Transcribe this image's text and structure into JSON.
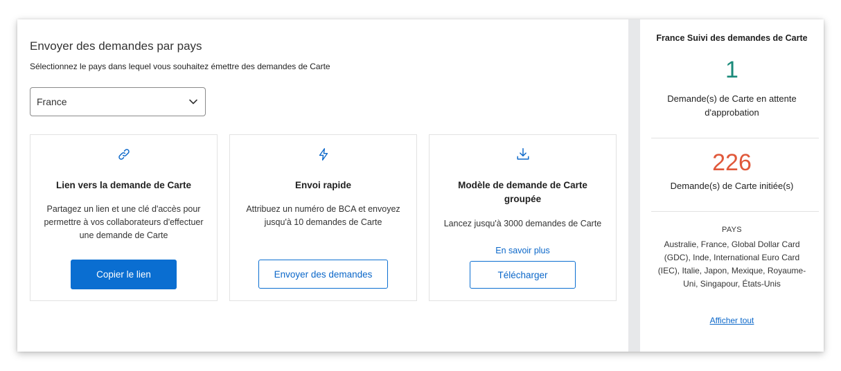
{
  "main": {
    "title": "Envoyer des demandes par pays",
    "subtitle": "Sélectionnez le pays dans lequel vous souhaitez émettre des demandes de Carte",
    "country_select": {
      "value": "France"
    }
  },
  "cards": [
    {
      "icon": "link-icon",
      "title": "Lien vers la demande de Carte",
      "description": "Partagez un lien et une clé d'accès pour permettre à vos collaborateurs d'effectuer une demande de Carte",
      "button": "Copier le lien"
    },
    {
      "icon": "lightning-icon",
      "title": "Envoi rapide",
      "description": "Attribuez un numéro de BCA et envoyez jusqu'à 10 demandes de Carte",
      "button": "Envoyer des demandes"
    },
    {
      "icon": "download-icon",
      "title": "Modèle de demande de Carte groupée",
      "description": "Lancez jusqu'à 3000 demandes de Carte",
      "link": "En savoir plus",
      "button": "Télécharger"
    }
  ],
  "sidebar": {
    "title": "France Suivi des demandes de Carte",
    "pending": {
      "value": "1",
      "label": "Demande(s) de Carte en attente d'approbation",
      "color": "#1a8a7a"
    },
    "initiated": {
      "value": "226",
      "label": "Demande(s) de Carte initiée(s)",
      "color": "#e0583a"
    },
    "pays_heading": "PAYS",
    "pays_list": "Australie, France, Global Dollar Card (GDC), Inde, International Euro Card (IEC), Italie, Japon, Mexique, Royaume-Uni, Singapour, États-Unis",
    "show_all": "Afficher tout"
  },
  "colors": {
    "accent": "#0a6ed1",
    "link": "#0b67c9"
  }
}
